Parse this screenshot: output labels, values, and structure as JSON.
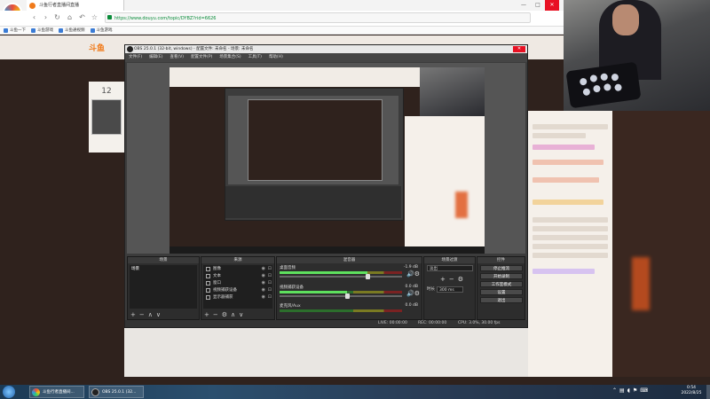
{
  "browser": {
    "badge": "搜新标签",
    "tab_title": "斗鱼行者直播间直播",
    "url": "https://www.douyu.com/topic/DYBZ?rid=6626",
    "bookmarks": [
      "斗鱼一下",
      "斗鱼游戏",
      "斗鱼通视频",
      "斗鱼游戏"
    ],
    "window_controls": [
      "—",
      "□",
      "✕"
    ]
  },
  "site": {
    "logo_text": "斗鱼",
    "room_number": "12"
  },
  "obs": {
    "title": "OBS 25.0.1 (32-bit, windows) - 配置文件: 未命名 - 场景: 未命名",
    "menu": [
      "文件(F)",
      "编辑(E)",
      "查看(V)",
      "配置文件(P)",
      "场景集合(S)",
      "工具(T)",
      "帮助(H)"
    ],
    "docks": {
      "scenes": {
        "title": "场景",
        "items": [
          "场景"
        ]
      },
      "sources": {
        "title": "来源",
        "items": [
          "图像",
          "文本",
          "窗口",
          "视频捕获设备",
          "显示器捕获"
        ]
      },
      "mixer": {
        "title": "混音器",
        "channels": [
          {
            "name": "桌面音频",
            "db": "-1.9 dB",
            "level": 0.72
          },
          {
            "name": "视频捕获设备",
            "db": "0.0 dB",
            "level": 0.55
          },
          {
            "name": "麦克风/Aux",
            "db": "0.0 dB",
            "level": 0.0
          }
        ]
      },
      "transitions": {
        "title": "场景过渡",
        "selected": "淡出",
        "duration_label": "时长",
        "duration": "300 ms"
      },
      "controls": {
        "title": "控件",
        "buttons": [
          "停止推流",
          "开始录制",
          "工作室模式",
          "设置",
          "退出"
        ]
      }
    },
    "status": {
      "live": "LIVE: 00:00:00",
      "rec": "REC: 00:00:00",
      "cpu": "CPU: 3.0%, 30.00 fps"
    }
  },
  "taskbar": {
    "items": [
      "斗鱼行者直播间...",
      "OBS 25.0.1 (32..."
    ],
    "clock_time": "0:54",
    "clock_date": "2022/8/25"
  },
  "colors": {
    "accent": "#f07a1a",
    "obs_bg": "#3c3c3c",
    "close": "#e81123",
    "meter_green": "#5ee05e"
  }
}
